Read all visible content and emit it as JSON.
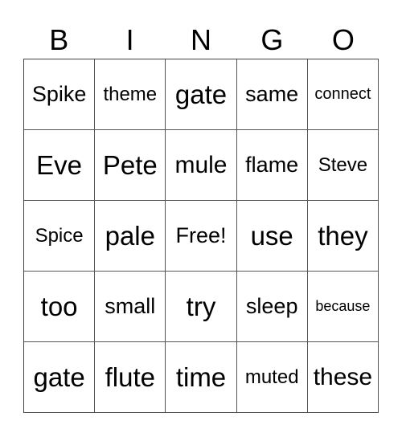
{
  "header": {
    "letters": [
      "B",
      "I",
      "N",
      "G",
      "O"
    ]
  },
  "card": {
    "rows": [
      [
        "Spike",
        "theme",
        "gate",
        "same",
        "connect"
      ],
      [
        "Eve",
        "Pete",
        "mule",
        "flame",
        "Steve"
      ],
      [
        "Spice",
        "pale",
        "Free!",
        "use",
        "they"
      ],
      [
        "too",
        "small",
        "try",
        "sleep",
        "because"
      ],
      [
        "gate",
        "flute",
        "time",
        "muted",
        "these"
      ]
    ]
  }
}
